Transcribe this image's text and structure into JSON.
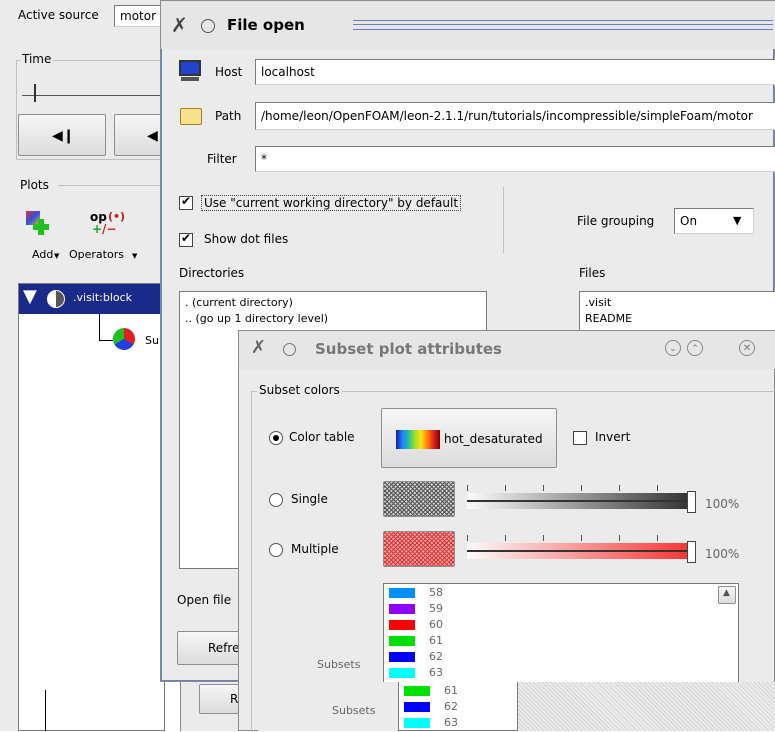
{
  "main_window": {
    "active_source_label": "Active source",
    "active_source_value": "motor",
    "time_label": "Time",
    "plots_label": "Plots",
    "add_label": "Add",
    "operators_label": "Operators",
    "op_icon_text": "op",
    "plot_list_item": ".visit:block",
    "plot_sub_item": "Su"
  },
  "file_open": {
    "title": "File open",
    "host_label": "Host",
    "host_value": "localhost",
    "path_label": "Path",
    "path_value": "/home/leon/OpenFOAM/leon-2.1.1/run/tutorials/incompressible/simpleFoam/motor",
    "filter_label": "Filter",
    "filter_value": "*",
    "use_cwd_label": "Use \"current working directory\" by default",
    "use_cwd_checked": true,
    "show_dot_label": "Show dot files",
    "show_dot_checked": true,
    "file_grouping_label": "File grouping",
    "file_grouping_value": "On",
    "directories_label": "Directories",
    "directories": [
      ". (current directory)",
      ".. (go up 1 directory level)"
    ],
    "files_label": "Files",
    "files": [
      ".visit",
      "README"
    ],
    "open_file_label": "Open file",
    "refresh_label": "Refre"
  },
  "subset_dialog": {
    "title": "Subset plot attributes",
    "subset_colors_label": "Subset colors",
    "color_table_label": "Color table",
    "color_table_value": "hot_desaturated",
    "invert_label": "Invert",
    "single_label": "Single",
    "multiple_label": "Multiple",
    "single_opacity": "100%",
    "multiple_opacity": "100%",
    "subsets_label": "Subsets",
    "subsets": [
      {
        "label": "58",
        "color": "#0090ff"
      },
      {
        "label": "59",
        "color": "#9000ff"
      },
      {
        "label": "60",
        "color": "#ff0000"
      },
      {
        "label": "61",
        "color": "#00e000"
      },
      {
        "label": "62",
        "color": "#0000ff"
      },
      {
        "label": "63",
        "color": "#00ffff"
      }
    ],
    "ghost_subsets": [
      {
        "label": "61",
        "color": "#00e000"
      },
      {
        "label": "62",
        "color": "#0000ff"
      },
      {
        "label": "63",
        "color": "#00ffff"
      }
    ],
    "ghost_subsets_label": "Subsets",
    "ghost_refresh_label": "Refre"
  }
}
